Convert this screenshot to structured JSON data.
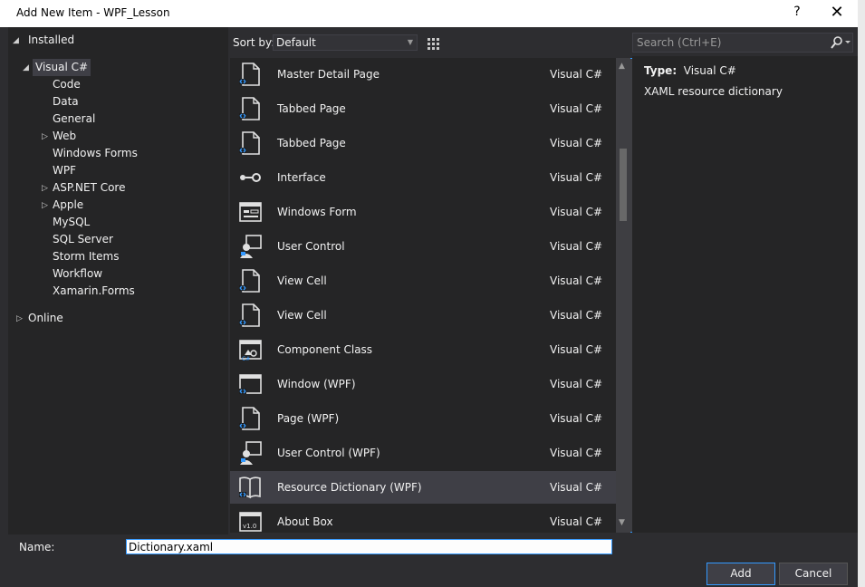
{
  "window": {
    "title": "Add New Item - WPF_Lesson",
    "help": "?",
    "close": "✕"
  },
  "tree": {
    "installed": "Installed",
    "visual_csharp": "Visual C#",
    "children": [
      "Code",
      "Data",
      "General",
      "Web",
      "Windows Forms",
      "WPF",
      "ASP.NET Core",
      "Apple",
      "MySQL",
      "SQL Server",
      "Storm Items",
      "Workflow",
      "Xamarin.Forms"
    ],
    "online": "Online"
  },
  "toolbar": {
    "sort_label": "Sort by:",
    "sort_value": "Default"
  },
  "items": [
    {
      "name": "Master Detail Page",
      "lang": "Visual C#",
      "icon": "xaml-page-icon"
    },
    {
      "name": "Tabbed Page",
      "lang": "Visual C#",
      "icon": "xaml-page-icon"
    },
    {
      "name": "Tabbed Page",
      "lang": "Visual C#",
      "icon": "xaml-page-icon"
    },
    {
      "name": "Interface",
      "lang": "Visual C#",
      "icon": "interface-icon"
    },
    {
      "name": "Windows Form",
      "lang": "Visual C#",
      "icon": "windows-form-icon"
    },
    {
      "name": "User Control",
      "lang": "Visual C#",
      "icon": "user-control-icon"
    },
    {
      "name": "View Cell",
      "lang": "Visual C#",
      "icon": "xaml-page-icon"
    },
    {
      "name": "View Cell",
      "lang": "Visual C#",
      "icon": "xaml-page-icon"
    },
    {
      "name": "Component Class",
      "lang": "Visual C#",
      "icon": "component-class-icon"
    },
    {
      "name": "Window (WPF)",
      "lang": "Visual C#",
      "icon": "window-wpf-icon"
    },
    {
      "name": "Page (WPF)",
      "lang": "Visual C#",
      "icon": "xaml-page-icon"
    },
    {
      "name": "User Control (WPF)",
      "lang": "Visual C#",
      "icon": "user-control-icon"
    },
    {
      "name": "Resource Dictionary (WPF)",
      "lang": "Visual C#",
      "icon": "resource-dictionary-icon"
    },
    {
      "name": "About Box",
      "lang": "Visual C#",
      "icon": "about-box-icon"
    }
  ],
  "selected_index": 12,
  "search": {
    "placeholder": "Search (Ctrl+E)"
  },
  "info": {
    "type_label": "Type:",
    "type_value": "Visual C#",
    "description": "XAML resource dictionary"
  },
  "bottom": {
    "name_label": "Name:",
    "name_value": "Dictionary.xaml",
    "add_label": "Add",
    "cancel_label": "Cancel"
  },
  "colors": {
    "accent": "#3399ff",
    "selection": "#3f3f46",
    "panel": "#252526",
    "frame": "#2d2d30"
  }
}
